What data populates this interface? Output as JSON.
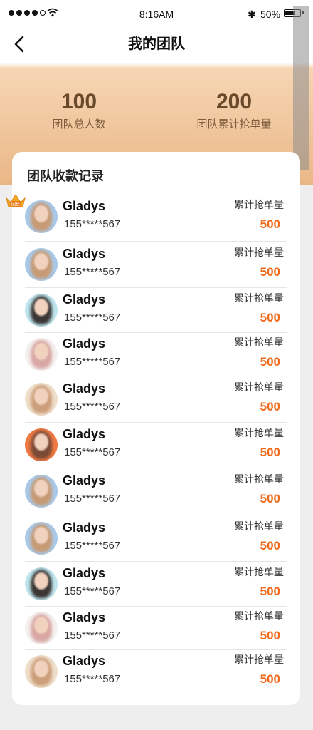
{
  "status_bar": {
    "time": "8:16AM",
    "battery": "50%"
  },
  "header": {
    "title": "我的团队"
  },
  "stats": [
    {
      "value": "100",
      "label": "团队总人数"
    },
    {
      "value": "200",
      "label": "团队累计抢单量"
    }
  ],
  "card": {
    "title": "团队收款记录",
    "leader_badge": "团长"
  },
  "members": [
    {
      "name": "Gladys",
      "phone": "155*****567",
      "label": "累计抢单量",
      "value": "500",
      "avatar": "blue"
    },
    {
      "name": "Gladys",
      "phone": "155*****567",
      "label": "累计抢单量",
      "value": "500",
      "avatar": "blue"
    },
    {
      "name": "Gladys",
      "phone": "155*****567",
      "label": "累计抢单量",
      "value": "500",
      "avatar": "cyan"
    },
    {
      "name": "Gladys",
      "phone": "155*****567",
      "label": "累计抢单量",
      "value": "500",
      "avatar": "pink"
    },
    {
      "name": "Gladys",
      "phone": "155*****567",
      "label": "累计抢单量",
      "value": "500",
      "avatar": "beige"
    },
    {
      "name": "Gladys",
      "phone": "155*****567",
      "label": "累计抢单量",
      "value": "500",
      "avatar": "orange"
    },
    {
      "name": "Gladys",
      "phone": "155*****567",
      "label": "累计抢单量",
      "value": "500",
      "avatar": "blue"
    },
    {
      "name": "Gladys",
      "phone": "155*****567",
      "label": "累计抢单量",
      "value": "500",
      "avatar": "blue"
    },
    {
      "name": "Gladys",
      "phone": "155*****567",
      "label": "累计抢单量",
      "value": "500",
      "avatar": "cyan"
    },
    {
      "name": "Gladys",
      "phone": "155*****567",
      "label": "累计抢单量",
      "value": "500",
      "avatar": "pink"
    },
    {
      "name": "Gladys",
      "phone": "155*****567",
      "label": "累计抢单量",
      "value": "500",
      "avatar": "beige"
    }
  ],
  "colors": {
    "accent": "#f06a1c",
    "header_gradient": "#ebb98a"
  }
}
